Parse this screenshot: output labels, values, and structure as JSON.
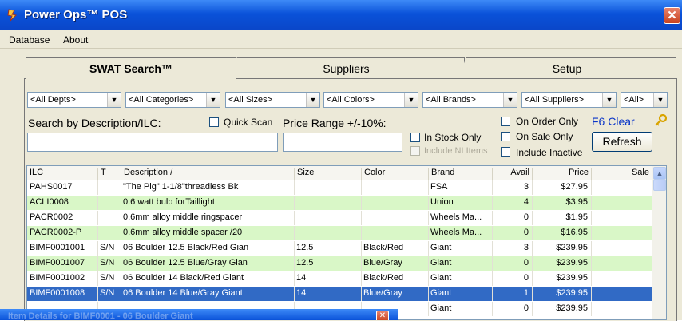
{
  "window": {
    "title": "Power Ops™ POS",
    "close_glyph": "✕",
    "icon": "app-icon"
  },
  "menu": {
    "database": "Database",
    "about": "About"
  },
  "tabs": [
    {
      "label": "SWAT Search™",
      "active": true
    },
    {
      "label": "Suppliers",
      "active": false
    },
    {
      "label": "Setup",
      "active": false
    }
  ],
  "filters": {
    "depts": "<All Depts>",
    "categories": "<All Categories>",
    "sizes": "<All Sizes>",
    "colors": "<All Colors>",
    "brands": "<All Brands>",
    "suppliers": "<All Suppliers>",
    "all": "<All>"
  },
  "search": {
    "desc_label": "Search by Description/ILC:",
    "desc_value": "",
    "quick_scan": "Quick Scan",
    "price_label": "Price Range +/-10%:",
    "price_value": "",
    "in_stock_only": "In Stock Only",
    "include_ni": "Include NI Items",
    "on_order_only": "On Order Only",
    "on_sale_only": "On Sale Only",
    "include_inactive": "Include Inactive",
    "f6_clear": "F6 Clear",
    "refresh": "Refresh"
  },
  "grid": {
    "columns": [
      "ILC",
      "T",
      "Description /",
      "Size",
      "Color",
      "Brand",
      "Avail",
      "Price",
      "Sale"
    ],
    "rows": [
      {
        "ilc": "PAHS0017",
        "t": "",
        "desc": "\"The Pig\" 1-1/8\"threadless Bk",
        "size": "",
        "color": "",
        "brand": "FSA",
        "avail": "3",
        "price": "$27.95",
        "sale": "",
        "style": "white"
      },
      {
        "ilc": "ACLI0008",
        "t": "",
        "desc": "0.6 watt bulb forTaillight",
        "size": "",
        "color": "",
        "brand": "Union",
        "avail": "4",
        "price": "$3.95",
        "sale": "",
        "style": "green"
      },
      {
        "ilc": "PACR0002",
        "t": "",
        "desc": "0.6mm alloy middle ringspacer",
        "size": "",
        "color": "",
        "brand": "Wheels Ma...",
        "avail": "0",
        "price": "$1.95",
        "sale": "",
        "style": "white"
      },
      {
        "ilc": "PACR0002-P",
        "t": "",
        "desc": "0.6mm alloy middle spacer /20",
        "size": "",
        "color": "",
        "brand": "Wheels Ma...",
        "avail": "0",
        "price": "$16.95",
        "sale": "",
        "style": "green"
      },
      {
        "ilc": "BIMF0001001",
        "t": "S/N",
        "desc": "06 Boulder 12.5 Black/Red Gian",
        "size": "12.5",
        "color": "Black/Red",
        "brand": "Giant",
        "avail": "3",
        "price": "$239.95",
        "sale": "",
        "style": "white"
      },
      {
        "ilc": "BIMF0001007",
        "t": "S/N",
        "desc": "06 Boulder 12.5 Blue/Gray Gian",
        "size": "12.5",
        "color": "Blue/Gray",
        "brand": "Giant",
        "avail": "0",
        "price": "$239.95",
        "sale": "",
        "style": "green"
      },
      {
        "ilc": "BIMF0001002",
        "t": "S/N",
        "desc": "06 Boulder 14 Black/Red Giant",
        "size": "14",
        "color": "Black/Red",
        "brand": "Giant",
        "avail": "0",
        "price": "$239.95",
        "sale": "",
        "style": "white"
      },
      {
        "ilc": "BIMF0001008",
        "t": "S/N",
        "desc": "06 Boulder 14 Blue/Gray Giant",
        "size": "14",
        "color": "Blue/Gray",
        "brand": "Giant",
        "avail": "1",
        "price": "$239.95",
        "sale": "",
        "style": "sel"
      },
      {
        "ilc": "",
        "t": "",
        "desc": "",
        "size": "",
        "color": "",
        "brand": "Giant",
        "avail": "0",
        "price": "$239.95",
        "sale": "",
        "style": "white"
      }
    ]
  },
  "subwindow": {
    "title": "Item Details for BIMF0001 - 06 Boulder Giant",
    "close_glyph": "✕"
  }
}
